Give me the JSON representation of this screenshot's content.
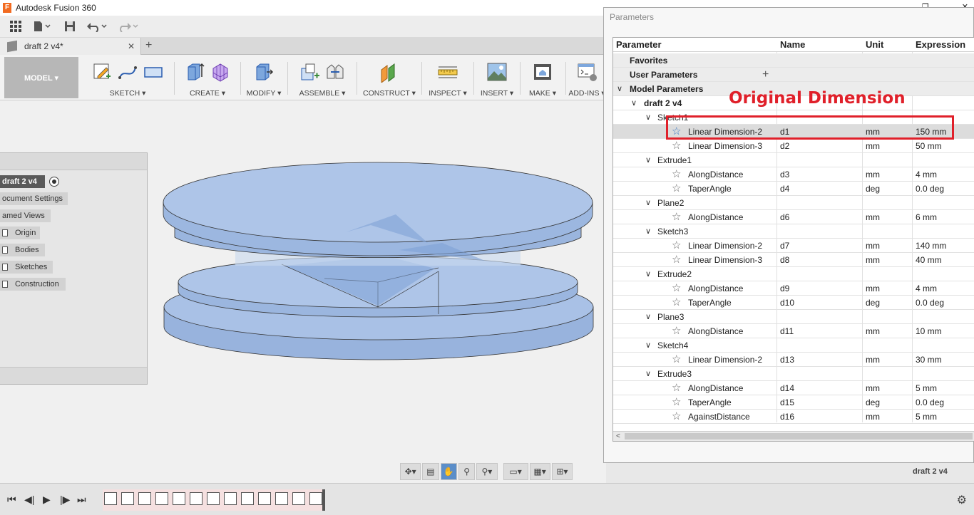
{
  "app": {
    "title": "Autodesk Fusion 360",
    "logo_letter": "F"
  },
  "window": {
    "restore": "❐",
    "close": "✕"
  },
  "tab": {
    "label": "draft 2 v4*",
    "close": "✕",
    "add": "+"
  },
  "ribbon": {
    "workspace": "MODEL ▾",
    "groups": [
      "SKETCH ▾",
      "CREATE ▾",
      "MODIFY ▾",
      "ASSEMBLE ▾",
      "CONSTRUCT ▾",
      "INSPECT ▾",
      "INSERT ▾",
      "MAKE ▾",
      "ADD-INS ▾"
    ]
  },
  "browser": {
    "root": "draft 2 v4",
    "items": [
      "ocument Settings",
      "amed Views",
      "Origin",
      "Bodies",
      "Sketches",
      "Construction"
    ]
  },
  "navbar": {
    "icons": [
      "orbit-icon",
      "look-at-icon",
      "pan-icon",
      "zoom-icon",
      "fit-icon",
      "display-icon",
      "grid-icon",
      "viewports-icon"
    ]
  },
  "status": {
    "document": "draft 2 v4"
  },
  "parameters": {
    "title": "Parameters",
    "columns": {
      "parameter": "Parameter",
      "name": "Name",
      "unit": "Unit",
      "expression": "Expression"
    },
    "favorites": "Favorites",
    "user_parameters": "User Parameters",
    "model_parameters": "Model Parameters",
    "root": "draft 2 v4",
    "rows": [
      {
        "kind": "feature",
        "label": "Sketch1"
      },
      {
        "kind": "param",
        "label": "Linear Dimension-2",
        "name": "d1",
        "unit": "mm",
        "expr": "150 mm",
        "selected": true
      },
      {
        "kind": "param",
        "label": "Linear Dimension-3",
        "name": "d2",
        "unit": "mm",
        "expr": "50 mm"
      },
      {
        "kind": "feature",
        "label": "Extrude1"
      },
      {
        "kind": "param",
        "label": "AlongDistance",
        "name": "d3",
        "unit": "mm",
        "expr": "4 mm"
      },
      {
        "kind": "param",
        "label": "TaperAngle",
        "name": "d4",
        "unit": "deg",
        "expr": "0.0 deg"
      },
      {
        "kind": "feature",
        "label": "Plane2"
      },
      {
        "kind": "param",
        "label": "AlongDistance",
        "name": "d6",
        "unit": "mm",
        "expr": "6 mm"
      },
      {
        "kind": "feature",
        "label": "Sketch3"
      },
      {
        "kind": "param",
        "label": "Linear Dimension-2",
        "name": "d7",
        "unit": "mm",
        "expr": "140 mm"
      },
      {
        "kind": "param",
        "label": "Linear Dimension-3",
        "name": "d8",
        "unit": "mm",
        "expr": "40 mm"
      },
      {
        "kind": "feature",
        "label": "Extrude2"
      },
      {
        "kind": "param",
        "label": "AlongDistance",
        "name": "d9",
        "unit": "mm",
        "expr": "4 mm"
      },
      {
        "kind": "param",
        "label": "TaperAngle",
        "name": "d10",
        "unit": "deg",
        "expr": "0.0 deg"
      },
      {
        "kind": "feature",
        "label": "Plane3"
      },
      {
        "kind": "param",
        "label": "AlongDistance",
        "name": "d11",
        "unit": "mm",
        "expr": "10 mm"
      },
      {
        "kind": "feature",
        "label": "Sketch4"
      },
      {
        "kind": "param",
        "label": "Linear Dimension-2",
        "name": "d13",
        "unit": "mm",
        "expr": "30 mm"
      },
      {
        "kind": "feature",
        "label": "Extrude3"
      },
      {
        "kind": "param",
        "label": "AlongDistance",
        "name": "d14",
        "unit": "mm",
        "expr": "5 mm"
      },
      {
        "kind": "param",
        "label": "TaperAngle",
        "name": "d15",
        "unit": "deg",
        "expr": "0.0 deg"
      },
      {
        "kind": "param",
        "label": "AgainstDistance",
        "name": "d16",
        "unit": "mm",
        "expr": "5 mm"
      }
    ]
  },
  "annotation": {
    "label": "Original Dimension",
    "color": "#e0202a"
  },
  "colors": {
    "model_fill": "#a9c1e6",
    "model_edge": "#3a3a3a",
    "selection_blue": "#5b8ec9"
  }
}
